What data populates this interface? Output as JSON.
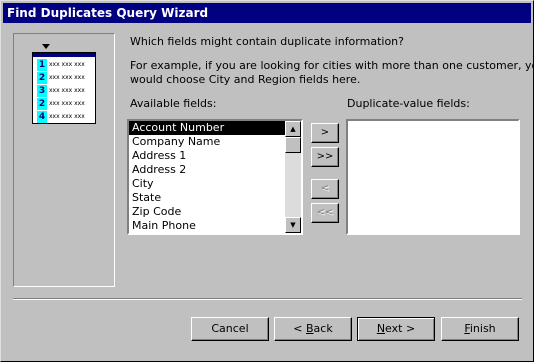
{
  "window": {
    "title": "Find Duplicates Query Wizard"
  },
  "illustration": {
    "rows": [
      "1",
      "2",
      "3",
      "2",
      "4"
    ],
    "cell_text": "xxx xxx xxx"
  },
  "instructions": {
    "question": "Which fields might contain duplicate information?",
    "example_line1": "For example, if you are looking for cities with more than one customer, you",
    "example_line2": "would choose City and Region fields here."
  },
  "available": {
    "label": "Available fields:",
    "items": [
      "Account Number",
      "Company Name",
      "Address 1",
      "Address 2",
      "City",
      "State",
      "Zip Code",
      "Main Phone"
    ],
    "selected": "Account Number"
  },
  "duplicate": {
    "label": "Duplicate-value fields:",
    "items": []
  },
  "move_buttons": {
    "add_one": ">",
    "add_all": ">>",
    "remove_one": "<",
    "remove_all": "<<"
  },
  "footer": {
    "cancel": "Cancel",
    "back_prefix": "< ",
    "back_hot": "B",
    "back_rest": "ack",
    "next_hot": "N",
    "next_rest": "ext >",
    "finish_hot": "F",
    "finish_rest": "inish"
  },
  "colors": {
    "titlebar": "#000080",
    "face": "#c0c0c0",
    "selection": "#000000",
    "illustration_accent": "#00ffff"
  },
  "icons": {
    "scroll_up": "triangle-up-icon",
    "scroll_down": "triangle-down-icon",
    "illustration_arrow": "down-arrow-icon"
  }
}
